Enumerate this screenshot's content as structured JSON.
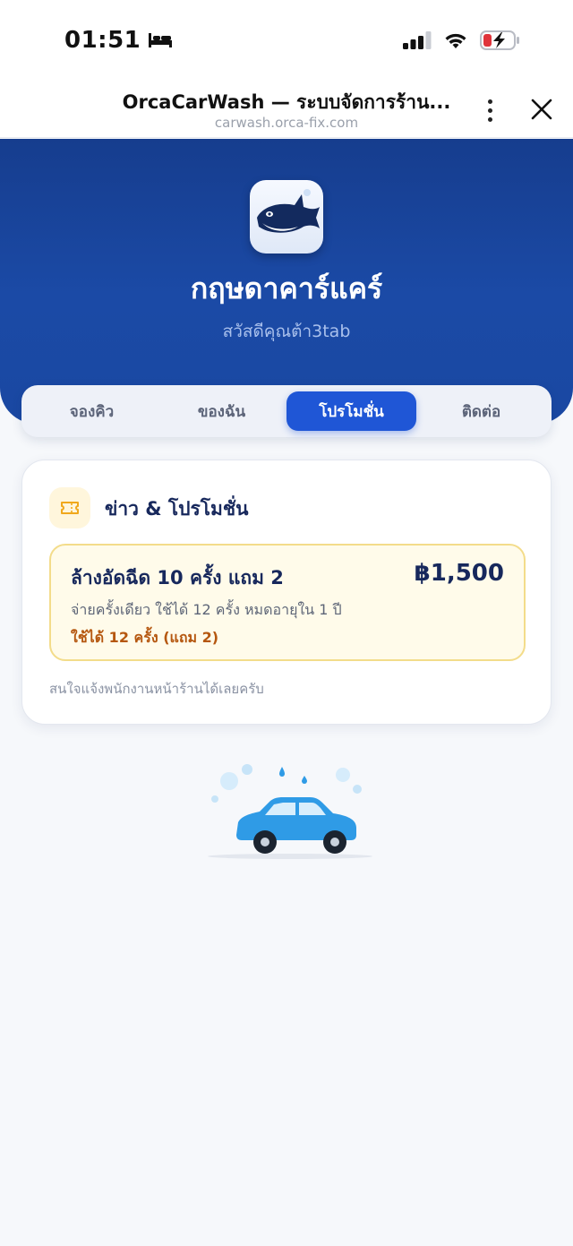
{
  "status_bar": {
    "time": "01:51"
  },
  "browser": {
    "title": "OrcaCarWash — ระบบจัดการร้าน...",
    "url": "carwash.orca-fix.com"
  },
  "hero": {
    "shop_name": "กฤษดาคาร์แคร์",
    "greeting": "สวัสดีคุณต้า3tab"
  },
  "tabs": [
    {
      "label": "จองคิว",
      "active": false
    },
    {
      "label": "ของฉัน",
      "active": false
    },
    {
      "label": "โปรโมชั่น",
      "active": true
    },
    {
      "label": "ติดต่อ",
      "active": false
    }
  ],
  "news": {
    "title": "ข่าว & โปรโมชั่น",
    "promo": {
      "title": "ล้างอัดฉีด 10 ครั้ง แถม 2",
      "price": "฿1,500",
      "description": "จ่ายครั้งเดียว ใช้ได้ 12 ครั้ง หมดอายุใน 1 ปี",
      "usage": "ใช้ได้ 12 ครั้ง (แถม 2)"
    },
    "footer": "สนใจแจ้งพนักงานหน้าร้านได้เลยครับ"
  },
  "colors": {
    "hero_bg": "#1b4aa6",
    "active_tab": "#1f56d6",
    "promo_bg": "#fffbea",
    "promo_border": "#f3dc8a",
    "usage_text": "#b5570f",
    "car": "#2f9be6"
  },
  "icons": {
    "bed": "bed-icon",
    "signal": "signal-icon",
    "wifi": "wifi-icon",
    "battery": "battery-charging-icon",
    "menu": "more-vertical-icon",
    "close": "close-icon",
    "logo": "orca-logo",
    "news": "ticket-icon",
    "illustration": "car-wash-illustration"
  }
}
